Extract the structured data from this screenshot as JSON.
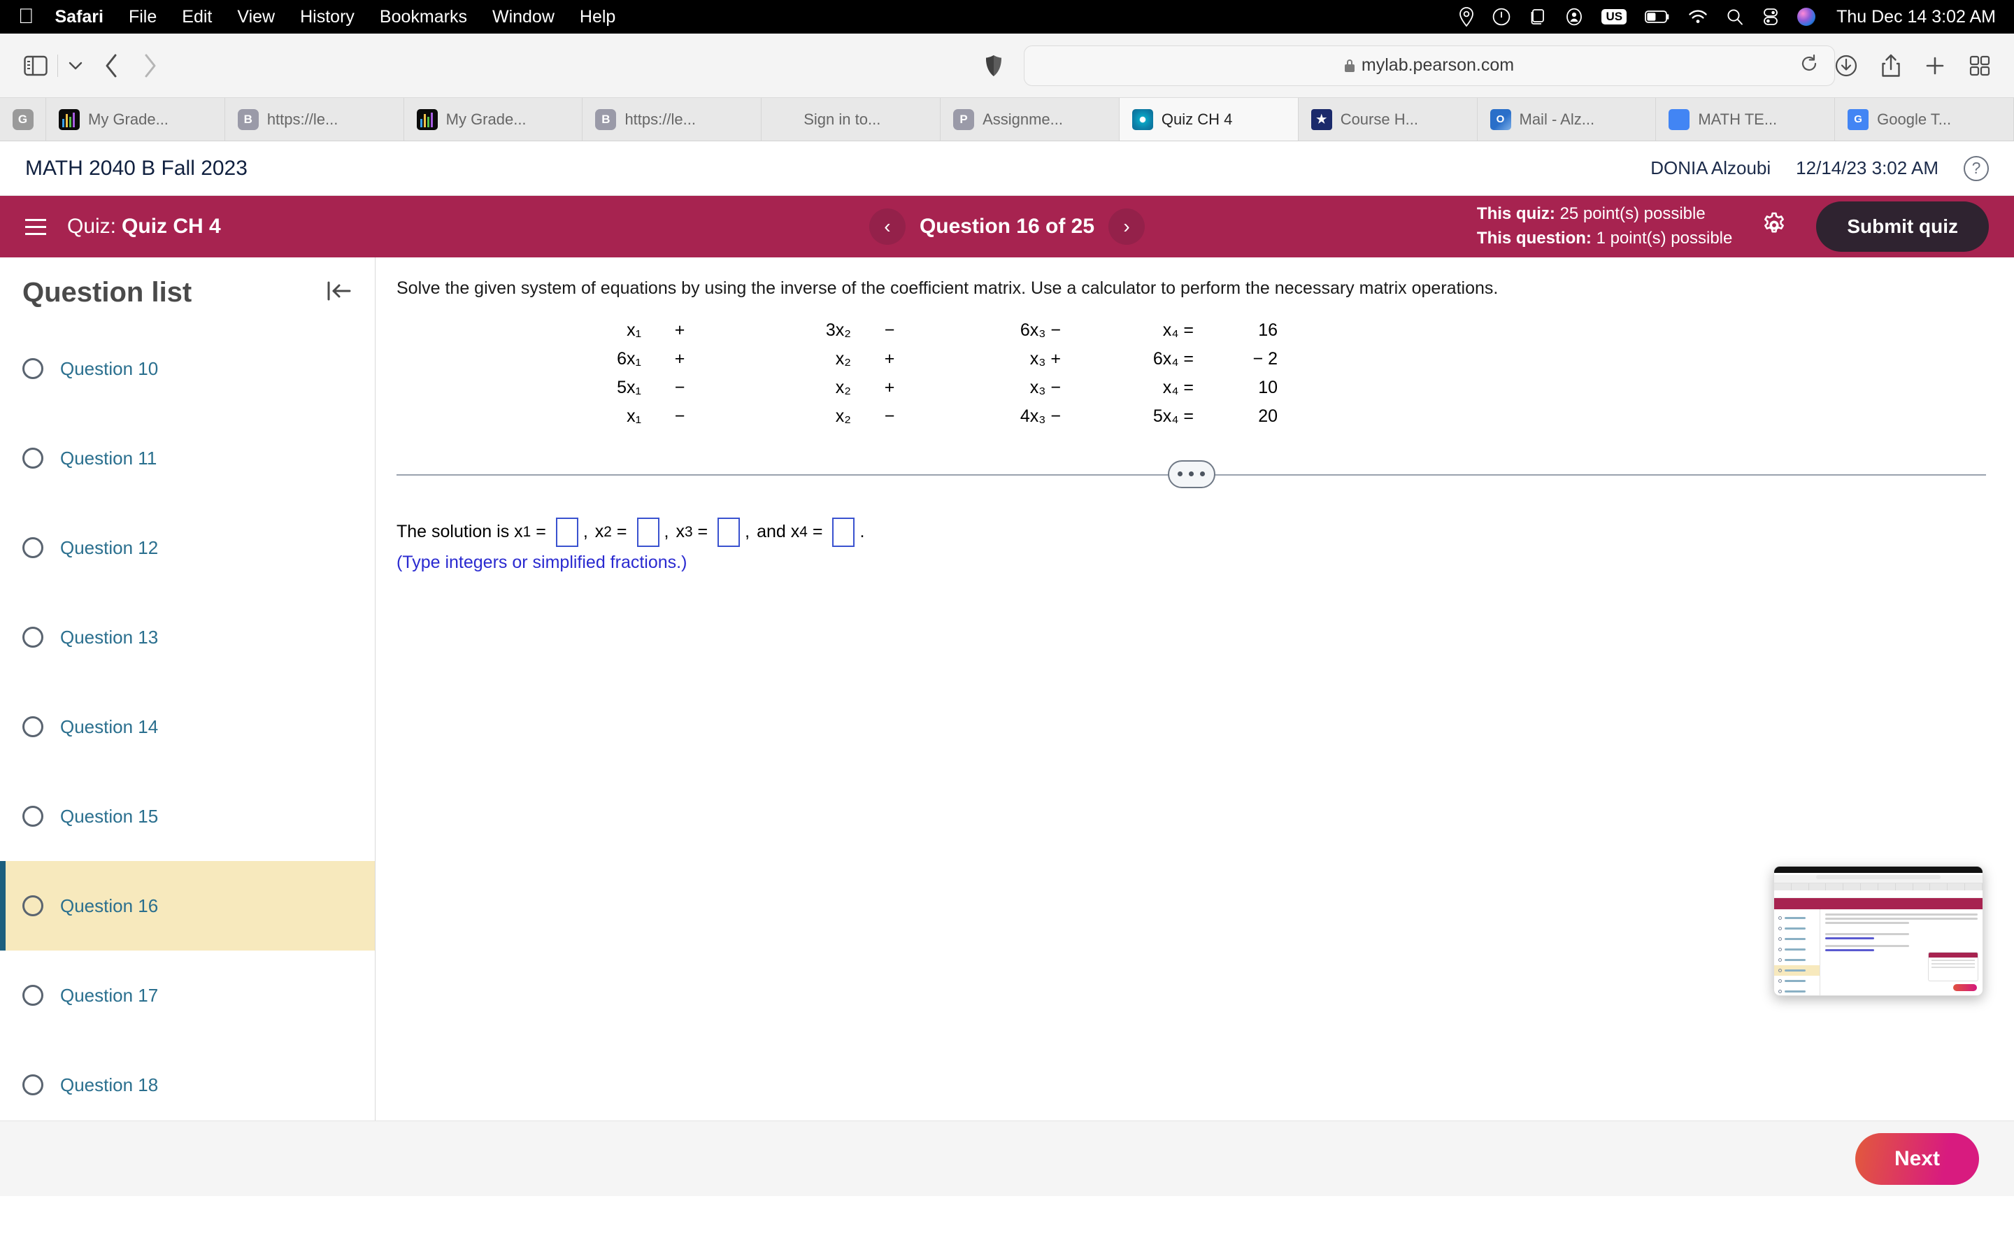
{
  "menubar": {
    "apple_icon": "apple-icon",
    "items": [
      {
        "label": "Safari",
        "bold": true
      },
      {
        "label": "File",
        "bold": false
      },
      {
        "label": "Edit",
        "bold": false
      },
      {
        "label": "View",
        "bold": false
      },
      {
        "label": "History",
        "bold": false
      },
      {
        "label": "Bookmarks",
        "bold": false
      },
      {
        "label": "Window",
        "bold": false
      },
      {
        "label": "Help",
        "bold": false
      }
    ],
    "tray_icons": [
      "location-icon",
      "clock-icon",
      "screen-mirroring-icon",
      "user-account-icon",
      "keyboard-layout-badge",
      "battery-icon",
      "wifi-icon",
      "search-icon",
      "control-center-icon",
      "siri-icon"
    ],
    "keyboard_layout": "US",
    "clock": "Thu Dec 14  3:02 AM"
  },
  "toolbar": {
    "sidebar_icon": "sidebar-toggle-icon",
    "chevron_icon": "chevron-down-icon",
    "back_icon": "back-arrow-icon",
    "forward_icon": "forward-arrow-icon",
    "shield_icon": "privacy-shield-icon",
    "url": "mylab.pearson.com",
    "lock_icon": "lock-icon",
    "reload_icon": "reload-icon",
    "download_icon": "download-icon",
    "share_icon": "share-icon",
    "newtab_icon": "new-tab-icon",
    "tabgroups_icon": "tab-overview-icon"
  },
  "tabs": [
    {
      "label": "",
      "icon": "google-favicon",
      "icon_letter": "G",
      "active": false,
      "first": true
    },
    {
      "label": "My Grade...",
      "icon": "bars-favicon",
      "active": false
    },
    {
      "label": "https://le...",
      "icon": "blackboard-favicon",
      "icon_letter": "B",
      "active": false
    },
    {
      "label": "My Grade...",
      "icon": "bars-favicon",
      "active": false
    },
    {
      "label": "https://le...",
      "icon": "blackboard-favicon",
      "icon_letter": "B",
      "active": false
    },
    {
      "label": "Sign in to...",
      "icon": "microsoft-favicon",
      "active": false
    },
    {
      "label": "Assignme...",
      "icon": "pearson-p-favicon",
      "icon_letter": "P",
      "active": false
    },
    {
      "label": "Quiz CH 4",
      "icon": "pearson-favicon",
      "active": true
    },
    {
      "label": "Course H...",
      "icon": "course-hero-favicon",
      "active": false
    },
    {
      "label": "Mail - Alz...",
      "icon": "outlook-favicon",
      "active": false
    },
    {
      "label": "MATH TE...",
      "icon": "google-docs-favicon",
      "active": false
    },
    {
      "label": "Google T...",
      "icon": "google-translate-favicon",
      "active": false
    }
  ],
  "course_header": {
    "title": "MATH 2040 B Fall 2023",
    "user": "DONIA Alzoubi",
    "timestamp": "12/14/23 3:02 AM",
    "help_icon": "help-icon"
  },
  "quizbar": {
    "menu_icon": "hamburger-menu-icon",
    "quiz_prefix": "Quiz:",
    "quiz_name": "Quiz CH 4",
    "prev_icon": "prev-question-icon",
    "next_icon": "next-question-icon",
    "question_counter": "Question 16 of 25",
    "quiz_points_label": "This quiz:",
    "quiz_points_value": "25 point(s) possible",
    "question_points_label": "This question:",
    "question_points_value": "1 point(s) possible",
    "settings_icon": "gear-icon",
    "submit_label": "Submit quiz",
    "accent_color": "#a72350",
    "submit_color": "#2f2330"
  },
  "sidebar": {
    "title": "Question list",
    "collapse_icon": "collapse-sidebar-icon",
    "items": [
      {
        "label": "Question 10",
        "selected": false
      },
      {
        "label": "Question 11",
        "selected": false
      },
      {
        "label": "Question 12",
        "selected": false
      },
      {
        "label": "Question 13",
        "selected": false
      },
      {
        "label": "Question 14",
        "selected": false
      },
      {
        "label": "Question 15",
        "selected": false
      },
      {
        "label": "Question 16",
        "selected": true
      },
      {
        "label": "Question 17",
        "selected": false
      },
      {
        "label": "Question 18",
        "selected": false
      }
    ],
    "selected_bg": "#f7e9bd",
    "link_color": "#2a6f8e"
  },
  "question": {
    "prompt": "Solve the given system of equations by using the inverse of the coefficient matrix.  Use a calculator to perform the necessary matrix operations.",
    "equations": [
      {
        "t1": "x₁",
        "op1": "+",
        "t2": "3x₂",
        "op2": "−",
        "t3": "6x₃ −",
        "t4": "x₄ =",
        "rhs": "16"
      },
      {
        "t1": "6x₁",
        "op1": "+",
        "t2": "x₂",
        "op2": "+",
        "t3": "x₃ +",
        "t4": "6x₄ =",
        "rhs": "− 2"
      },
      {
        "t1": "5x₁",
        "op1": "−",
        "t2": "x₂",
        "op2": "+",
        "t3": "x₃ −",
        "t4": "x₄ =",
        "rhs": "10"
      },
      {
        "t1": "x₁",
        "op1": "−",
        "t2": "x₂",
        "op2": "−",
        "t3": "4x₃ −",
        "t4": "5x₄ =",
        "rhs": "20"
      }
    ],
    "expand_icon": "expand-dots-icon",
    "answer_prefix": "The solution is x",
    "answer_parts": [
      {
        "label": "The solution is x",
        "sub": "1",
        "eq": "=",
        "value": "",
        "trail": ","
      },
      {
        "label": "x",
        "sub": "2",
        "eq": "=",
        "value": "",
        "trail": ","
      },
      {
        "label": "x",
        "sub": "3",
        "eq": "=",
        "value": "",
        "trail": ","
      },
      {
        "label": "and x",
        "sub": "4",
        "eq": "=",
        "value": "",
        "trail": "."
      }
    ],
    "hint": "(Type integers or simplified fractions.)",
    "hint_color": "#2a2ad0",
    "input_border_color": "#3a52cf"
  },
  "pip": {
    "name": "picture-in-picture-preview"
  },
  "bottom": {
    "next_label": "Next"
  }
}
